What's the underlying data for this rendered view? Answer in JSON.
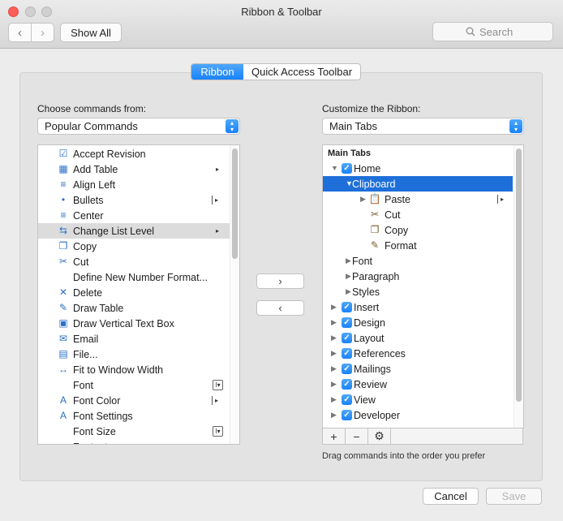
{
  "window": {
    "title": "Ribbon & Toolbar"
  },
  "toolbar": {
    "show_all": "Show All",
    "search_placeholder": "Search"
  },
  "tabs": {
    "ribbon": "Ribbon",
    "quick_access": "Quick Access Toolbar"
  },
  "left": {
    "label": "Choose commands from:",
    "select_value": "Popular Commands",
    "items": [
      {
        "label": "Accept Revision",
        "icon": "accept-revision-icon",
        "glyph": "☑"
      },
      {
        "label": "Add Table",
        "icon": "table-icon",
        "glyph": "▦",
        "sub": "▸"
      },
      {
        "label": "Align Left",
        "icon": "align-left-icon",
        "glyph": "≡"
      },
      {
        "label": "Bullets",
        "icon": "bullets-icon",
        "glyph": "•",
        "subbar": "▸"
      },
      {
        "label": "Center",
        "icon": "center-icon",
        "glyph": "≡"
      },
      {
        "label": "Change List Level",
        "icon": "list-level-icon",
        "glyph": "⇆",
        "sub": "▸",
        "selected": true
      },
      {
        "label": "Copy",
        "icon": "copy-icon",
        "glyph": "❐"
      },
      {
        "label": "Cut",
        "icon": "scissors-icon",
        "glyph": "✂"
      },
      {
        "label": "Define New Number Format...",
        "icon": "",
        "glyph": ""
      },
      {
        "label": "Delete",
        "icon": "delete-icon",
        "glyph": "✕"
      },
      {
        "label": "Draw Table",
        "icon": "draw-table-icon",
        "glyph": "✎"
      },
      {
        "label": "Draw Vertical Text Box",
        "icon": "text-box-icon",
        "glyph": "▣"
      },
      {
        "label": "Email",
        "icon": "email-icon",
        "glyph": "✉"
      },
      {
        "label": "File...",
        "icon": "file-icon",
        "glyph": "▤"
      },
      {
        "label": "Fit to Window Width",
        "icon": "fit-width-icon",
        "glyph": "↔"
      },
      {
        "label": "Font",
        "icon": "",
        "glyph": "",
        "subbox": "I▾"
      },
      {
        "label": "Font Color",
        "icon": "font-color-icon",
        "glyph": "A",
        "subbar": "▸"
      },
      {
        "label": "Font Settings",
        "icon": "font-settings-icon",
        "glyph": "A"
      },
      {
        "label": "Font Size",
        "icon": "",
        "glyph": "",
        "subbox": "I▾"
      },
      {
        "label": "Footnote",
        "icon": "",
        "glyph": ""
      }
    ]
  },
  "middle": {
    "add": "›",
    "remove": "‹"
  },
  "right": {
    "label": "Customize the Ribbon:",
    "select_value": "Main Tabs",
    "header": "Main Tabs",
    "items": [
      {
        "label": "Home",
        "level": 0,
        "disc": "▼",
        "check": true
      },
      {
        "label": "Clipboard",
        "level": 1,
        "disc": "▼",
        "selected": true
      },
      {
        "label": "Paste",
        "level": 2,
        "disc": "▶",
        "icon": "paste-icon",
        "glyph": "📋",
        "subbar": "▸"
      },
      {
        "label": "Cut",
        "level": 2,
        "icon": "scissors-icon",
        "glyph": "✂"
      },
      {
        "label": "Copy",
        "level": 2,
        "icon": "copy-icon",
        "glyph": "❐"
      },
      {
        "label": "Format",
        "level": 2,
        "icon": "format-painter-icon",
        "glyph": "✎"
      },
      {
        "label": "Font",
        "level": 1,
        "disc": "▶"
      },
      {
        "label": "Paragraph",
        "level": 1,
        "disc": "▶"
      },
      {
        "label": "Styles",
        "level": 1,
        "disc": "▶"
      },
      {
        "label": "Insert",
        "level": 0,
        "disc": "▶",
        "check": true
      },
      {
        "label": "Design",
        "level": 0,
        "disc": "▶",
        "check": true
      },
      {
        "label": "Layout",
        "level": 0,
        "disc": "▶",
        "check": true
      },
      {
        "label": "References",
        "level": 0,
        "disc": "▶",
        "check": true
      },
      {
        "label": "Mailings",
        "level": 0,
        "disc": "▶",
        "check": true
      },
      {
        "label": "Review",
        "level": 0,
        "disc": "▶",
        "check": true
      },
      {
        "label": "View",
        "level": 0,
        "disc": "▶",
        "check": true
      },
      {
        "label": "Developer",
        "level": 0,
        "disc": "▶",
        "check": true
      }
    ],
    "footer_buttons": [
      "+",
      "−",
      "⚙"
    ],
    "hint": "Drag commands into the order you prefer"
  },
  "actions": {
    "cancel": "Cancel",
    "save": "Save"
  },
  "colors": {
    "accent": "#1a82fb",
    "selection": "#1e6fd9",
    "close": "#fc5f57"
  }
}
